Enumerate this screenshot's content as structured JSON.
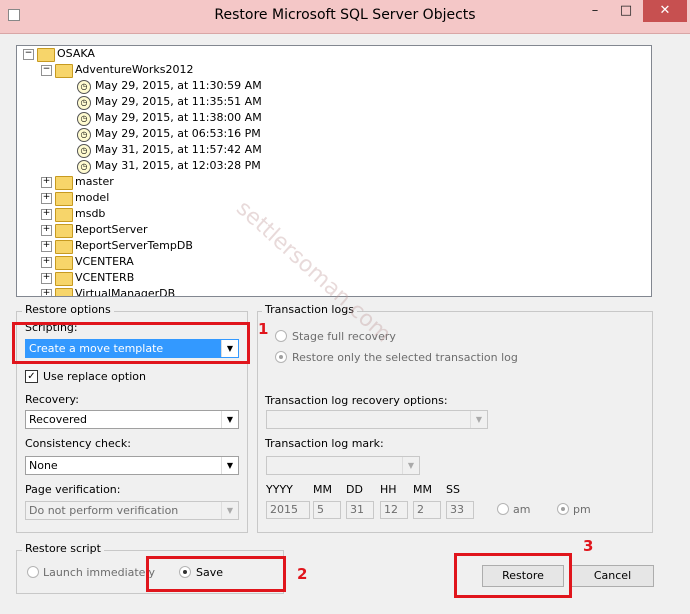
{
  "window": {
    "title": "Restore Microsoft SQL Server Objects"
  },
  "tree": {
    "root": "OSAKA",
    "database": "AdventureWorks2012",
    "restore_points": [
      "May 29, 2015, at 11:30:59 AM",
      "May 29, 2015, at 11:35:51 AM",
      "May 29, 2015, at 11:38:00 AM",
      "May 29, 2015, at 06:53:16 PM",
      "May 31, 2015, at 11:57:42 AM",
      "May 31, 2015, at 12:03:28 PM"
    ],
    "other_databases": [
      "master",
      "model",
      "msdb",
      "ReportServer",
      "ReportServerTempDB",
      "VCENTERA",
      "VCENTERB",
      "VirtualManagerDB"
    ]
  },
  "restore_options": {
    "group_label": "Restore options",
    "scripting_label": "Scripting:",
    "scripting_value": "Create a move template",
    "replace_label": "Use replace option",
    "replace_checked": true,
    "recovery_label": "Recovery:",
    "recovery_value": "Recovered",
    "consistency_label": "Consistency check:",
    "consistency_value": "None",
    "page_verification_label": "Page verification:",
    "page_verification_value": "Do not perform verification"
  },
  "transaction_logs": {
    "group_label": "Transaction logs",
    "stage_label": "Stage full recovery",
    "restore_only_label": "Restore only the selected transaction log",
    "recovery_options_label": "Transaction log recovery options:",
    "mark_label": "Transaction log mark:",
    "date_headers": [
      "YYYY",
      "MM",
      "DD",
      "HH",
      "MM",
      "SS"
    ],
    "date_values": [
      "2015",
      "5",
      "31",
      "12",
      "2",
      "33"
    ],
    "am_label": "am",
    "pm_label": "pm"
  },
  "restore_script": {
    "group_label": "Restore script",
    "launch_label": "Launch immediately",
    "save_label": "Save"
  },
  "buttons": {
    "restore": "Restore",
    "cancel": "Cancel"
  },
  "annotations": [
    "1",
    "2",
    "3"
  ],
  "watermark": "settlersoman.com",
  "colors": {
    "titlebar": "#f4c7c7",
    "annotation": "#e0151c",
    "selection": "#3399ff"
  }
}
